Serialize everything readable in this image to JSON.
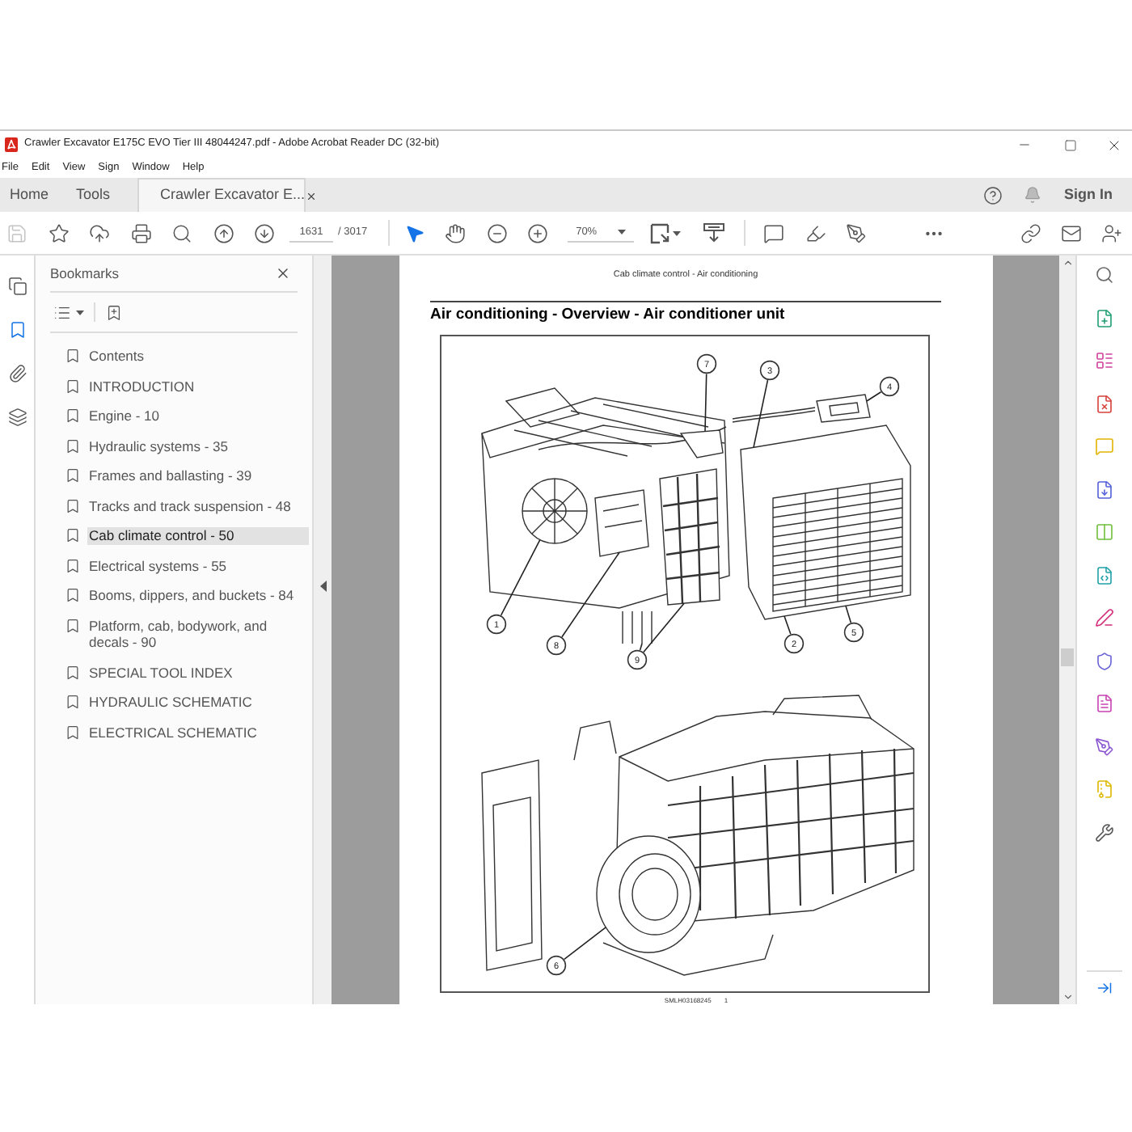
{
  "window": {
    "title": "Crawler Excavator E175C EVO Tier III 48044247.pdf - Adobe Acrobat Reader DC (32-bit)"
  },
  "menu": [
    "File",
    "Edit",
    "View",
    "Sign",
    "Window",
    "Help"
  ],
  "tabs": [
    {
      "label": "Home",
      "selected": false
    },
    {
      "label": "Tools",
      "selected": false
    },
    {
      "label": "Crawler Excavator E...",
      "selected": true
    }
  ],
  "account": {
    "sign_in": "Sign In"
  },
  "toolbar": {
    "save": {
      "disabled": true
    },
    "page_number": "1631",
    "page_count": "/ 3017",
    "tools": [
      {
        "kind": "select",
        "selected": true
      },
      {
        "kind": "hand",
        "selected": false
      }
    ],
    "zoom": "70%"
  },
  "left_rail": [
    {
      "selected": false
    },
    {
      "selected": true
    },
    {
      "selected": false
    },
    {
      "selected": false
    }
  ],
  "bookmarks": {
    "title": "Bookmarks",
    "items": [
      {
        "label": "Contents",
        "selected": false
      },
      {
        "label": "INTRODUCTION",
        "selected": false
      },
      {
        "label": "Engine - 10",
        "selected": false
      },
      {
        "label": "Hydraulic systems - 35",
        "selected": false
      },
      {
        "label": "Frames and ballasting - 39",
        "selected": false
      },
      {
        "label": "Tracks and track suspension - 48",
        "selected": false
      },
      {
        "label": "Cab climate control - 50",
        "selected": true
      },
      {
        "label": "Electrical systems - 55",
        "selected": false
      },
      {
        "label": "Booms, dippers, and buckets - 84",
        "selected": false
      },
      {
        "label": "Platform, cab, bodywork, and decals - 90",
        "selected": false
      },
      {
        "label": "SPECIAL TOOL INDEX",
        "selected": false
      },
      {
        "label": "HYDRAULIC SCHEMATIC",
        "selected": false
      },
      {
        "label": "ELECTRICAL SCHEMATIC",
        "selected": false
      }
    ]
  },
  "document": {
    "running_head": "Cab climate control - Air conditioning",
    "heading": "Air conditioning - Overview - Air conditioner unit",
    "callouts": [
      "7",
      "3",
      "4",
      "1",
      "8",
      "9",
      "2",
      "5",
      "6"
    ],
    "footer_code": "SMLH03168245",
    "footer_page": "1"
  }
}
